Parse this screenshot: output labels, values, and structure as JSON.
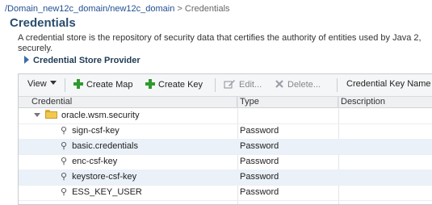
{
  "breadcrumb": {
    "path": "/Domain_new12c_domain/new12c_domain",
    "separator": ">",
    "current": "Credentials"
  },
  "page": {
    "title": "Credentials",
    "description": "A credential store is the repository of security data that certifies the authority of entities used by Java 2, securely.",
    "provider_label": "Credential Store Provider"
  },
  "toolbar": {
    "view_label": "View",
    "create_map_label": "Create Map",
    "create_key_label": "Create Key",
    "edit_label": "Edit...",
    "delete_label": "Delete...",
    "credential_key_name_label": "Credential Key Name"
  },
  "table": {
    "columns": [
      "Credential",
      "Type",
      "Description"
    ],
    "map": {
      "name": "oracle.wsm.security"
    },
    "rows": [
      {
        "credential": "sign-csf-key",
        "type": "Password",
        "description": ""
      },
      {
        "credential": "basic.credentials",
        "type": "Password",
        "description": ""
      },
      {
        "credential": "enc-csf-key",
        "type": "Password",
        "description": ""
      },
      {
        "credential": "keystore-csf-key",
        "type": "Password",
        "description": ""
      },
      {
        "credential": "ESS_KEY_USER",
        "type": "Password",
        "description": ""
      }
    ]
  },
  "icons": {
    "view_menu": "chevron-down-icon",
    "create_map": "plus-icon",
    "create_key": "plus-icon",
    "edit": "edit-icon",
    "delete": "delete-icon",
    "map_row": "folder-icon",
    "credential_row": "key-icon",
    "provider": "triangle-right-icon"
  },
  "colors": {
    "title": "#2a4d6e",
    "link": "#1f4f8f",
    "add": "#2e9a2e",
    "folder": "#f2c94c"
  }
}
